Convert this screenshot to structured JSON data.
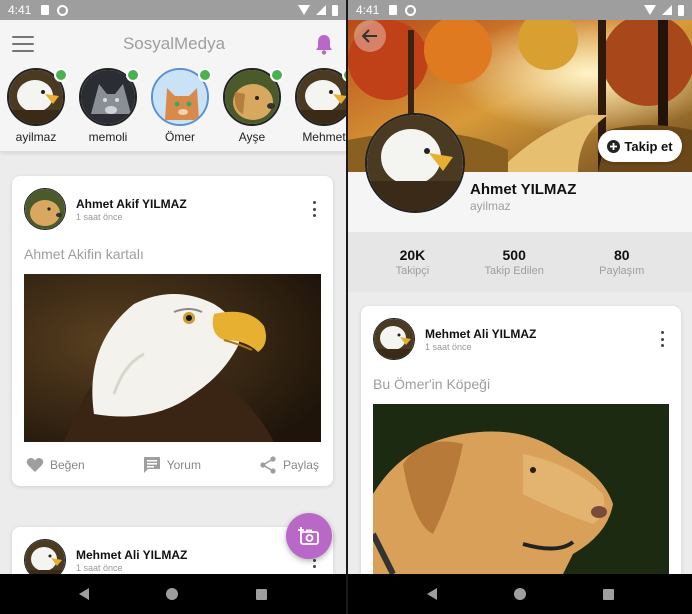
{
  "status": {
    "time": "4:41"
  },
  "feed_screen": {
    "app_title": "SosyalMedya",
    "stories": [
      {
        "label": "ayilmaz",
        "image": "eagle"
      },
      {
        "label": "memoli",
        "image": "wolf"
      },
      {
        "label": "Ömer",
        "image": "cat"
      },
      {
        "label": "Ayşe",
        "image": "dog"
      },
      {
        "label": "Mehmet",
        "image": "eagle"
      }
    ],
    "posts": [
      {
        "author": "Ahmet Akif YILMAZ",
        "time": "1 saat önce",
        "text": "Ahmet Akifin kartalı",
        "image": "eagle",
        "actions": {
          "like": "Beğen",
          "comment": "Yorum",
          "share": "Paylaş"
        }
      },
      {
        "author": "Mehmet Ali YILMAZ",
        "time": "1 saat önce"
      }
    ]
  },
  "profile_screen": {
    "follow_label": "Takip et",
    "name": "Ahmet YILMAZ",
    "username": "ayilmaz",
    "stats": [
      {
        "value": "20K",
        "label": "Takipçi"
      },
      {
        "value": "500",
        "label": "Takip Edilen"
      },
      {
        "value": "80",
        "label": "Paylaşım"
      }
    ],
    "post": {
      "author": "Mehmet Ali YILMAZ",
      "time": "1 saat önce",
      "text": "Bu Ömer'in Köpeği",
      "image": "dog"
    }
  },
  "colors": {
    "accent": "#ba68c8",
    "online": "#4caf50",
    "statusbar": "#9e9e9e",
    "navbar": "#000000"
  }
}
